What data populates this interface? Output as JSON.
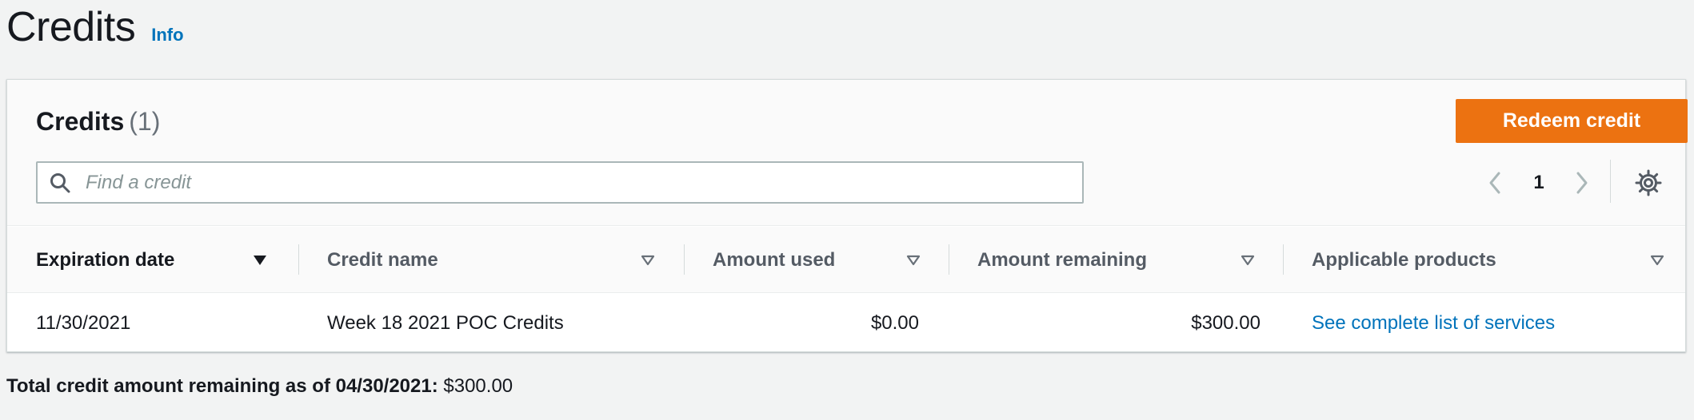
{
  "header": {
    "title": "Credits",
    "info_link": "Info"
  },
  "panel": {
    "title": "Credits",
    "count": "(1)",
    "redeem_button": "Redeem credit",
    "search": {
      "placeholder": "Find a credit",
      "value": ""
    },
    "pagination": {
      "current_page": "1"
    },
    "columns": [
      {
        "label": "Expiration date",
        "sorted": true
      },
      {
        "label": "Credit name",
        "sorted": false
      },
      {
        "label": "Amount used",
        "sorted": false
      },
      {
        "label": "Amount remaining",
        "sorted": false
      },
      {
        "label": "Applicable products",
        "sorted": false
      }
    ],
    "rows": [
      {
        "expiration_date": "11/30/2021",
        "credit_name": "Week 18 2021 POC Credits",
        "amount_used": "$0.00",
        "amount_remaining": "$300.00",
        "applicable_products": "See complete list of services"
      }
    ]
  },
  "footer": {
    "label": "Total credit amount remaining as of 04/30/2021:",
    "value": "$300.00"
  },
  "colors": {
    "accent": "#ec7211",
    "link": "#0073bb",
    "background": "#f2f3f3"
  }
}
